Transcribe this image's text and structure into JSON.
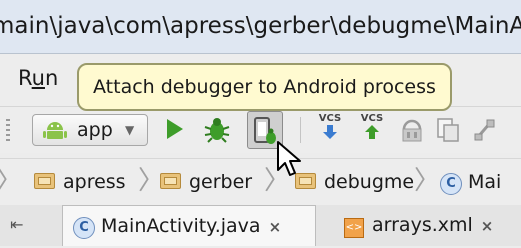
{
  "window": {
    "title": "main\\java\\com\\apress\\gerber\\debugme\\MainActivit"
  },
  "menubar": {
    "run_label_prefix": "R",
    "run_label_underlined": "u",
    "run_label_suffix": "n"
  },
  "tooltip": {
    "text": "Attach debugger to Android process"
  },
  "toolbar": {
    "run_config": "app",
    "vcs_update_label": "VCS",
    "vcs_commit_label": "VCS"
  },
  "breadcrumb": {
    "items": [
      "apress",
      "gerber",
      "debugme",
      "Mai"
    ]
  },
  "tabs": [
    {
      "label": "MainActivity.java",
      "close": "×"
    },
    {
      "label": "arrays.xml",
      "close": "×"
    }
  ],
  "colors": {
    "run_green": "#3e9d2a",
    "android_green": "#8bc34a",
    "tooltip_bg": "#fffad0",
    "vcs_blue": "#3b7cd0"
  }
}
